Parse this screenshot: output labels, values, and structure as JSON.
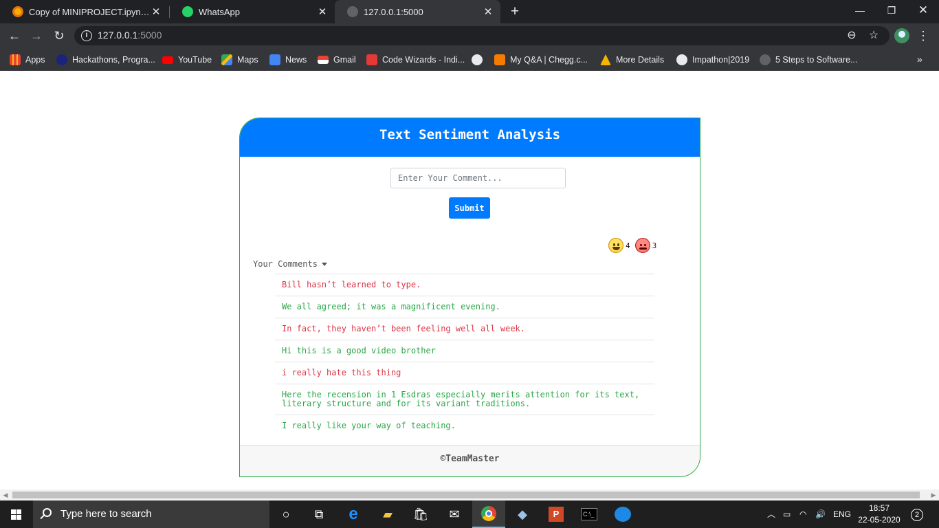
{
  "browser": {
    "tabs": [
      {
        "title": "Copy of MINIPROJECT.ipynb - Co",
        "icon": "colab-icon",
        "active": false
      },
      {
        "title": "WhatsApp",
        "icon": "whatsapp-icon",
        "active": false
      },
      {
        "title": "127.0.0.1:5000",
        "icon": "globe-icon",
        "active": true
      }
    ],
    "url_host": "127.0.0.1",
    "url_rest": ":5000",
    "bookmarks": [
      {
        "label": "Apps",
        "icon": "apps-grid-icon"
      },
      {
        "label": "Hackathons, Progra...",
        "icon": "bookmark-site-icon"
      },
      {
        "label": "YouTube",
        "icon": "youtube-icon"
      },
      {
        "label": "Maps",
        "icon": "maps-icon"
      },
      {
        "label": "News",
        "icon": "news-icon"
      },
      {
        "label": "Gmail",
        "icon": "gmail-icon"
      },
      {
        "label": "Code Wizards - Indi...",
        "icon": "codewizards-icon"
      },
      {
        "label": "",
        "icon": "globe-icon"
      },
      {
        "label": "My Q&A | Chegg.c...",
        "icon": "chegg-icon"
      },
      {
        "label": "More Details",
        "icon": "bookmark-site-icon"
      },
      {
        "label": "Impathon|2019",
        "icon": "globe-icon"
      },
      {
        "label": "5 Steps to Software...",
        "icon": "bookmark-site-icon"
      }
    ]
  },
  "app": {
    "title": "Text Sentiment Analysis",
    "input_placeholder": "Enter Your Comment...",
    "submit_label": "Submit",
    "positive_count": "4",
    "negative_count": "3",
    "comments_label": "Your Comments",
    "comments": [
      {
        "text": "Bill hasn’t learned to type.",
        "sentiment": "negative"
      },
      {
        "text": "We all agreed; it was a magnificent evening.",
        "sentiment": "positive"
      },
      {
        "text": "In fact, they haven’t been feeling well all week.",
        "sentiment": "negative"
      },
      {
        "text": "Hi this is a good video brother",
        "sentiment": "positive"
      },
      {
        "text": "i really hate this thing",
        "sentiment": "negative"
      },
      {
        "text": "Here the recension in 1 Esdras especially merits attention for its text, literary structure and for its variant traditions.",
        "sentiment": "positive"
      },
      {
        "text": "I really like your way of teaching.",
        "sentiment": "positive"
      }
    ],
    "footer": "©TeamMaster",
    "colors": {
      "primary": "#007bff",
      "positive": "#28a745",
      "negative": "#dc3545"
    }
  },
  "taskbar": {
    "search_placeholder": "Type here to search",
    "language": "ENG",
    "time": "18:57",
    "date": "22-05-2020",
    "notifications": "2"
  }
}
